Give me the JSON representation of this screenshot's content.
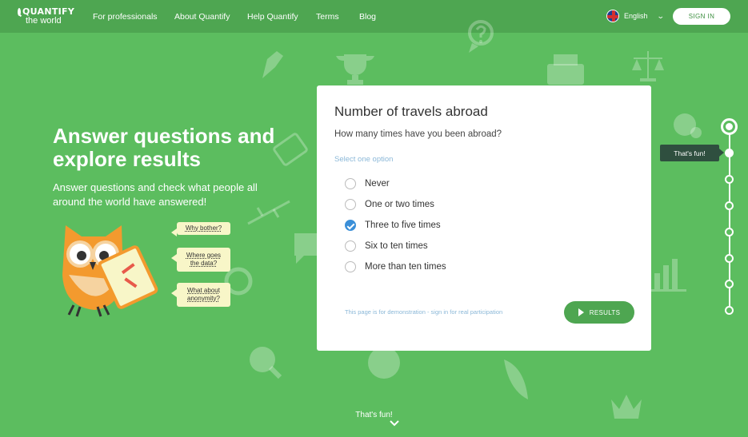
{
  "header": {
    "logo_top": "QUANTIFY",
    "logo_bottom": "the world",
    "nav": [
      "For professionals",
      "About Quantify",
      "Help Quantify",
      "Terms",
      "Blog"
    ],
    "language": "English",
    "sign_in": "SIGN IN"
  },
  "hero": {
    "title": "Answer questions and explore results",
    "subtitle": "Answer questions and check what people all around the world have answered!",
    "bubbles": [
      "Why bother?",
      "Where goes the data?",
      "What about anonymity?"
    ]
  },
  "card": {
    "title": "Number of travels abroad",
    "question": "How many times have you been abroad?",
    "hint": "Select one option",
    "options": [
      {
        "label": "Never",
        "checked": false
      },
      {
        "label": "One or two times",
        "checked": false
      },
      {
        "label": "Three to five times",
        "checked": true
      },
      {
        "label": "Six to ten times",
        "checked": false
      },
      {
        "label": "More than ten times",
        "checked": false
      }
    ],
    "demo_note": "This page is for demonstration - sign in for real participation",
    "results_button": "RESULTS"
  },
  "progress": {
    "tooltip": "That's fun!",
    "steps": 8,
    "current_step": 1
  },
  "footer": {
    "label": "That's fun!"
  },
  "colors": {
    "background": "#5cbd5f",
    "header": "#4ea651",
    "accent_blue": "#3b8fd8",
    "button_green": "#4ea651"
  }
}
